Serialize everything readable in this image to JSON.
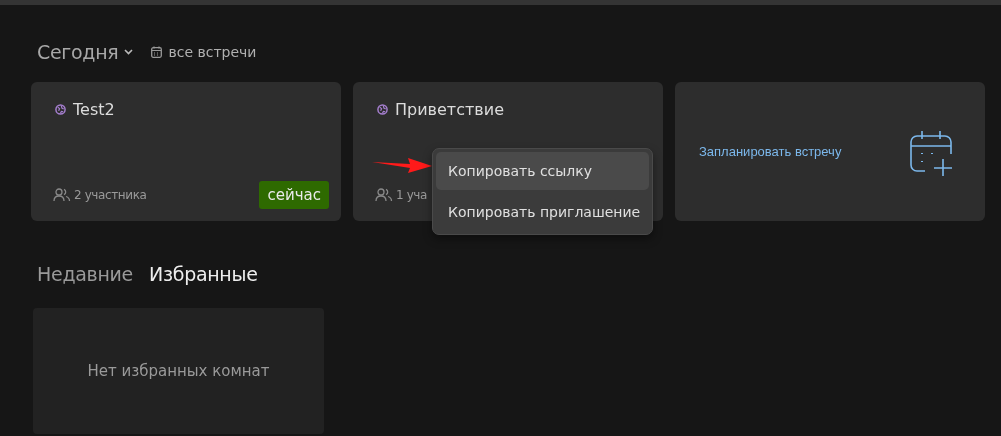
{
  "header": {
    "title": "Сегодня",
    "link": "все встречи"
  },
  "meetings": [
    {
      "title": "Test2",
      "participants": "2 участника",
      "badge": "сейчас"
    },
    {
      "title": "Приветствие",
      "participants": "1 уча"
    }
  ],
  "schedule": {
    "label": "Запланировать встречу"
  },
  "context_menu": {
    "items": [
      {
        "label": "Копировать ссылку",
        "selected": true
      },
      {
        "label": "Копировать приглашение",
        "selected": false
      }
    ]
  },
  "tabs": [
    {
      "label": "Недавние",
      "selected": false
    },
    {
      "label": "Избранные",
      "selected": true
    }
  ],
  "empty_state": "Нет избранных комнат"
}
